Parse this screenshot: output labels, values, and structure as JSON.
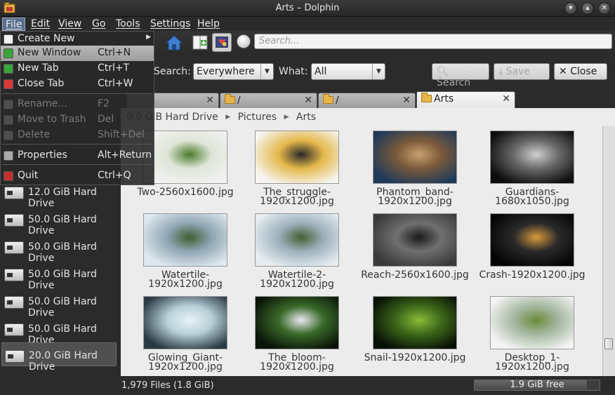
{
  "window": {
    "title": "Arts – Dolphin"
  },
  "menubar": [
    "File",
    "Edit",
    "View",
    "Go",
    "Tools",
    "Settings",
    "Help"
  ],
  "file_menu": [
    {
      "label": "Create New",
      "shortcut": "",
      "submenu": true,
      "enabled": true,
      "icon": "document-new-icon"
    },
    {
      "label": "New Window",
      "shortcut": "Ctrl+N",
      "enabled": true,
      "highlighted": true,
      "icon": "window-new-icon"
    },
    {
      "label": "New Tab",
      "shortcut": "Ctrl+T",
      "enabled": true,
      "icon": "tab-new-icon"
    },
    {
      "label": "Close Tab",
      "shortcut": "Ctrl+W",
      "enabled": true,
      "icon": "tab-close-icon"
    },
    {
      "label": "Rename...",
      "shortcut": "F2",
      "enabled": false,
      "icon": "rename-icon"
    },
    {
      "label": "Move to Trash",
      "shortcut": "Del",
      "enabled": false,
      "icon": "trash-icon"
    },
    {
      "label": "Delete",
      "shortcut": "Shift+Del",
      "enabled": false,
      "icon": "delete-icon"
    },
    {
      "label": "Properties",
      "shortcut": "Alt+Return",
      "enabled": true,
      "icon": "properties-icon"
    },
    {
      "label": "Quit",
      "shortcut": "Ctrl+Q",
      "enabled": true,
      "icon": "quit-icon"
    }
  ],
  "toolbar": {
    "search_placeholder": "Search..."
  },
  "filter": {
    "search_label": "Search:",
    "search_value": "Everywhere",
    "what_label": "What:",
    "what_value": "All",
    "search_button": "Search",
    "save_button": "Save",
    "close_button": "Close"
  },
  "tabs": [
    {
      "label": "",
      "active": false
    },
    {
      "label": "/",
      "active": false
    },
    {
      "label": "/",
      "active": false
    },
    {
      "label": "Arts",
      "active": true
    }
  ],
  "breadcrumb": [
    "0.0 GiB Hard Drive",
    "Pictures",
    "Arts"
  ],
  "places": [
    {
      "label": "12.0 GiB Hard Drive",
      "selected": false
    },
    {
      "label": "50.0 GiB Hard Drive",
      "selected": false
    },
    {
      "label": "50.0 GiB Hard Drive",
      "selected": false
    },
    {
      "label": "50.0 GiB Hard Drive",
      "selected": false
    },
    {
      "label": "50.0 GiB Hard Drive",
      "selected": false
    },
    {
      "label": "50.0 GiB Hard Drive",
      "selected": false
    },
    {
      "label": "20.0 GiB Hard Drive",
      "selected": true
    }
  ],
  "files": [
    {
      "name": "Two-2560x1600.jpg",
      "colors": [
        "#f2f2f2",
        "#dfe6d8",
        "#4c7a2a"
      ]
    },
    {
      "name": "The_struggle-1920x1200.jpg",
      "colors": [
        "#f6f4ee",
        "#e4b84a",
        "#2a2a2a"
      ]
    },
    {
      "name": "Phantom_band-1920x1200.jpg",
      "colors": [
        "#1f3a5a",
        "#7b5a3a",
        "#c8a070"
      ]
    },
    {
      "name": "Guardians-1680x1050.jpg",
      "colors": [
        "#0d0d0d",
        "#6a6a6a",
        "#cfcfcf"
      ]
    },
    {
      "name": "Watertile-1920x1200.jpg",
      "colors": [
        "#dfe8ee",
        "#8fa6b4",
        "#3e5e2e"
      ]
    },
    {
      "name": "Watertile-2-1920x1200.jpg",
      "colors": [
        "#e6ecf0",
        "#9cb0bc",
        "#445f32"
      ]
    },
    {
      "name": "Reach-2560x1600.jpg",
      "colors": [
        "#3a3a3a",
        "#707070",
        "#1a1a1a"
      ]
    },
    {
      "name": "Crash-1920x1200.jpg",
      "colors": [
        "#050505",
        "#2a2a2a",
        "#d89a3a"
      ]
    },
    {
      "name": "Glowing_Giant-1920x1200.jpg",
      "colors": [
        "#2a3a44",
        "#b8d0d8",
        "#e8f4f8"
      ]
    },
    {
      "name": "The_bloom-1920x1200.jpg",
      "colors": [
        "#0a1408",
        "#3a6a2a",
        "#e8e8f0"
      ]
    },
    {
      "name": "Snail-1920x1200.jpg",
      "colors": [
        "#081006",
        "#3e6a1a",
        "#8abb3a"
      ]
    },
    {
      "name": "Desktop_1-1920x1200.jpg",
      "colors": [
        "#f4f4f4",
        "#a4b8a0",
        "#6a8a3a"
      ]
    }
  ],
  "status": {
    "text": "1,979 Files (1.8 GiB)",
    "free": "1.9 GiB free",
    "used_fraction": 0.9
  },
  "colors": {
    "menu_highlight": "#b8b8b8",
    "active_menu": "#5a6f8c"
  }
}
